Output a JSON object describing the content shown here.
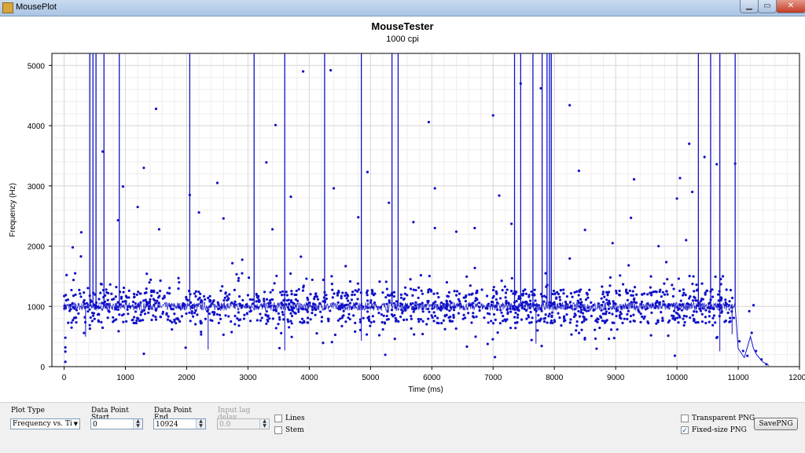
{
  "window": {
    "title": "MousePlot"
  },
  "chart_data": {
    "type": "scatter",
    "title": "MouseTester",
    "subtitle": "1000 cpi",
    "xlabel": "Time (ms)",
    "ylabel": "Frequency (Hz)",
    "xlim": [
      -200,
      12000
    ],
    "ylim": [
      0,
      5200
    ],
    "xticks": [
      0,
      1000,
      2000,
      3000,
      4000,
      5000,
      6000,
      7000,
      8000,
      9000,
      10000,
      11000,
      12000
    ],
    "yticks": [
      0,
      1000,
      2000,
      3000,
      4000,
      5000
    ],
    "grid": true,
    "series": [
      {
        "style": "line+points",
        "color": "#1010c8",
        "baseline": 1000,
        "spikes_x": [
          420,
          470,
          520,
          650,
          900,
          2050,
          3100,
          3600,
          4250,
          4850,
          5350,
          5450,
          7350,
          7450,
          7650,
          7800,
          7880,
          7920,
          7950,
          10350,
          10550,
          10700,
          10950
        ],
        "outliers": [
          [
            1500,
            4280
          ],
          [
            1300,
            3300
          ],
          [
            630,
            3570
          ],
          [
            3450,
            4010
          ],
          [
            3900,
            4900
          ],
          [
            4350,
            4920
          ],
          [
            3300,
            3390
          ],
          [
            5950,
            4060
          ],
          [
            7000,
            4170
          ],
          [
            7450,
            4700
          ],
          [
            7780,
            4620
          ],
          [
            8250,
            4340
          ],
          [
            10200,
            3700
          ],
          [
            10450,
            3480
          ],
          [
            4950,
            3230
          ],
          [
            8400,
            3250
          ],
          [
            9300,
            3110
          ],
          [
            10650,
            3360
          ],
          [
            10950,
            3370
          ],
          [
            2500,
            3050
          ],
          [
            2050,
            2850
          ],
          [
            3700,
            2820
          ],
          [
            6050,
            2960
          ],
          [
            7100,
            2840
          ],
          [
            960,
            2990
          ],
          [
            880,
            2430
          ],
          [
            9250,
            2470
          ],
          [
            2600,
            2460
          ],
          [
            4800,
            2480
          ],
          [
            6050,
            2300
          ],
          [
            8500,
            2270
          ],
          [
            1550,
            2280
          ],
          [
            140,
            1980
          ],
          [
            280,
            2230
          ],
          [
            3400,
            2280
          ],
          [
            5700,
            2400
          ],
          [
            6700,
            2300
          ],
          [
            9700,
            2000
          ],
          [
            10150,
            2100
          ],
          [
            10000,
            2790
          ],
          [
            10250,
            2900
          ],
          [
            10050,
            3130
          ],
          [
            1200,
            2650
          ],
          [
            2200,
            2560
          ],
          [
            4400,
            2960
          ],
          [
            5300,
            2720
          ],
          [
            6400,
            2240
          ],
          [
            7300,
            2370
          ],
          [
            8950,
            2050
          ]
        ]
      }
    ]
  },
  "controls": {
    "plot_type_label": "Plot Type",
    "plot_type_value": "Frequency vs. Ti",
    "start_label": "Data Point Start",
    "start_value": "0",
    "end_label": "Data Point End",
    "end_value": "10924",
    "lag_label": "Input lag delay",
    "lag_value": "0.0",
    "lines_label": "Lines",
    "stem_label": "Stem",
    "transparent_label": "Transparent PNG",
    "fixed_size_label": "Fixed-size PNG",
    "save_label": "SavePNG",
    "lines_checked": false,
    "stem_checked": false,
    "transparent_checked": false,
    "fixed_size_checked": true
  }
}
